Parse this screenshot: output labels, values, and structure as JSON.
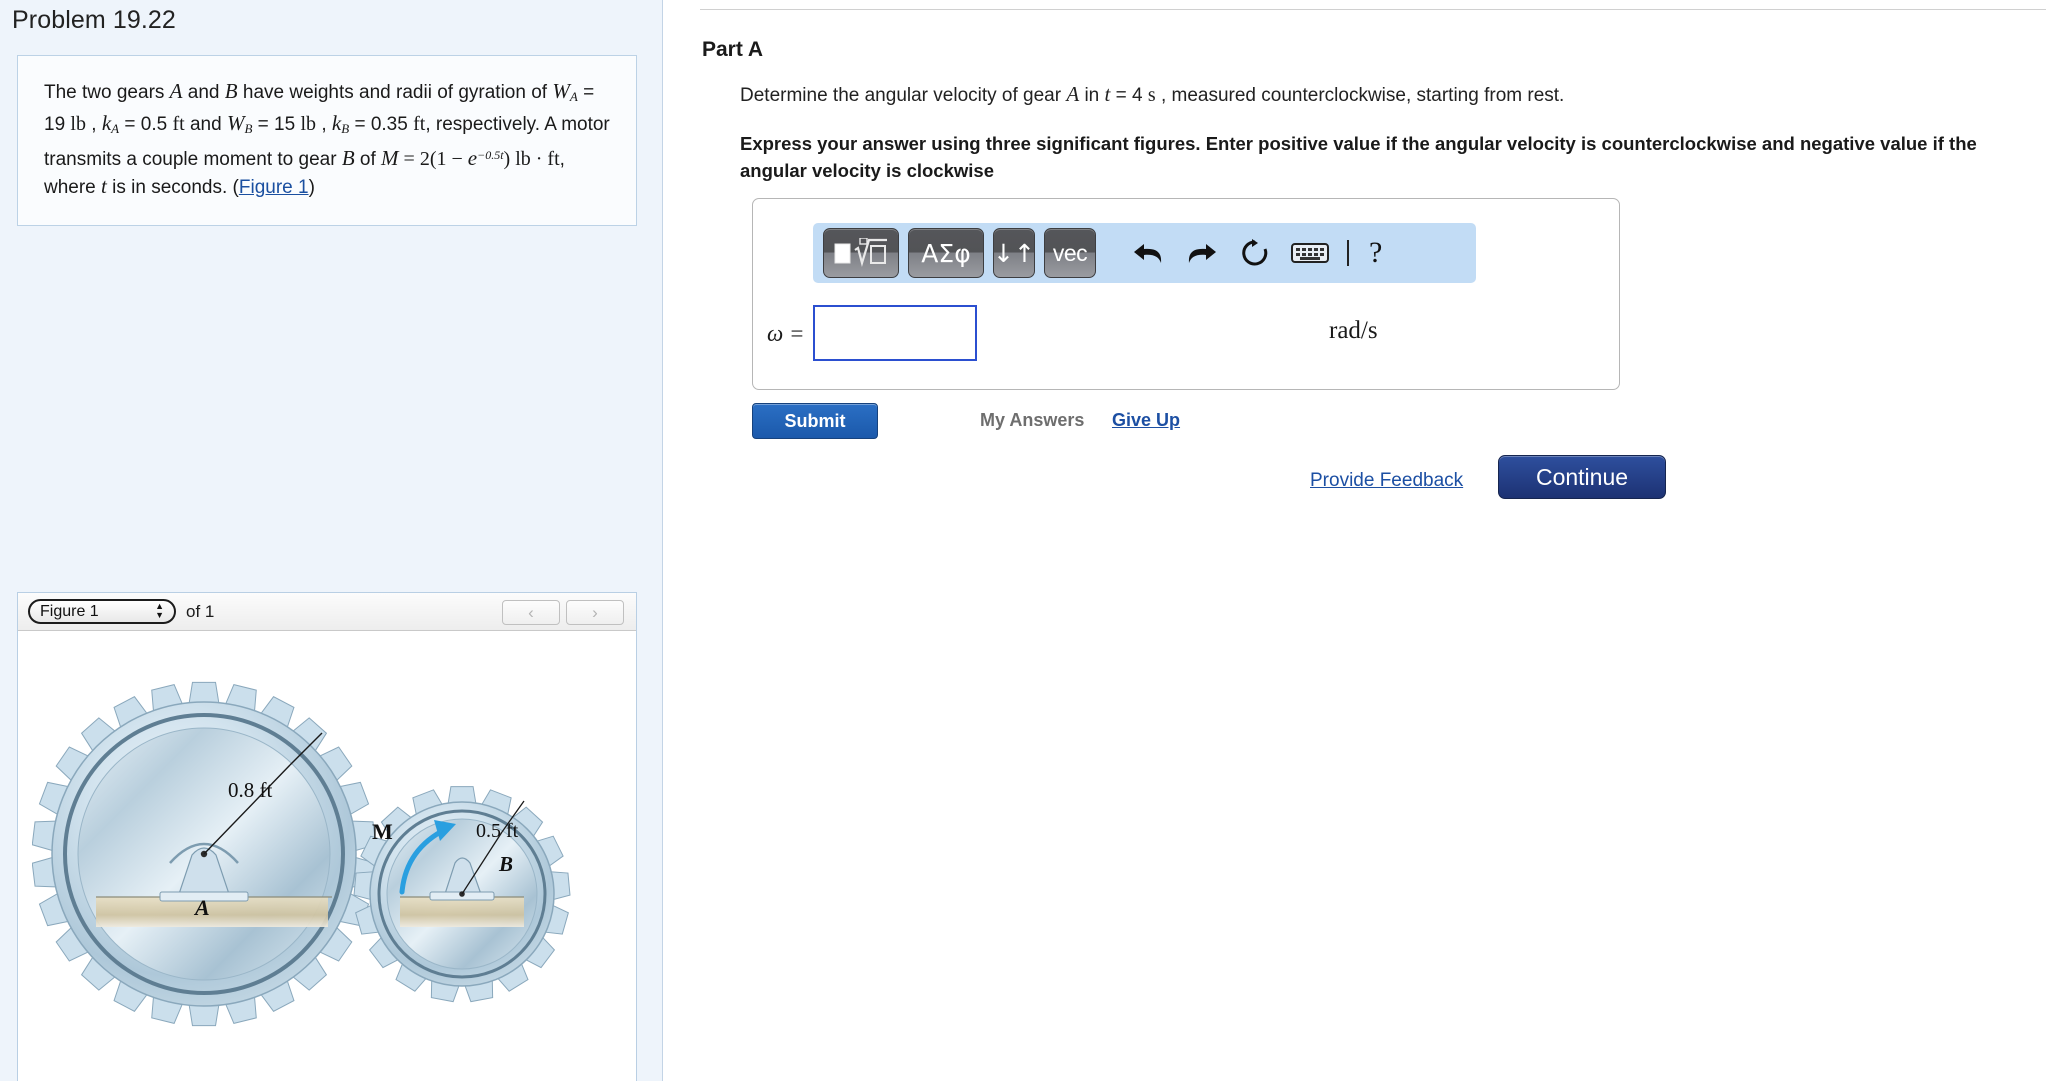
{
  "problem": {
    "title": "Problem 19.22",
    "statement_parts": {
      "p1": "The two gears ",
      "gear_a": "A",
      "p2": " and ",
      "gear_b": "B",
      "p3": " have weights and radii of gyration of ",
      "w_a": "W",
      "w_a_sub": "A",
      "eq1": " = 19 ",
      "unit_lb1": "lb",
      "comma1": " , ",
      "k_a": "k",
      "k_a_sub": "A",
      "eq2": " = 0.5 ",
      "unit_ft1": "ft",
      "and1": " and ",
      "w_b": "W",
      "w_b_sub": "B",
      "eq3": " = 15 ",
      "unit_lb2": "lb",
      "comma2": " , ",
      "k_b": "k",
      "k_b_sub": "B",
      "eq4": " = 0.35 ",
      "unit_ft2": "ft",
      "p4": ", respectively. A motor transmits a couple moment to gear ",
      "gear_b2": "B",
      "p5": " of ",
      "m_sym": "M",
      "m_eq": " = 2(1 − ",
      "e_sym": "e",
      "e_exp": "−0.5t",
      "m_close": ") ",
      "unit_lbft": "lb · ft",
      "p6": ", where ",
      "t_sym": "t",
      "p7": " is in seconds. (",
      "figure_link": "Figure 1",
      "p8": ")"
    }
  },
  "figure_panel": {
    "selected_figure": "Figure 1",
    "options": [
      "Figure 1"
    ],
    "of_label": "of 1",
    "prev_label": "‹",
    "next_label": "›",
    "figure_labels": {
      "radius_a": "0.8 ft",
      "radius_b": "0.5 ft",
      "gear_a": "A",
      "gear_b": "B",
      "moment": "M"
    }
  },
  "part": {
    "title": "Part A",
    "question_parts": {
      "q1": "Determine the angular velocity of gear ",
      "gear": "A",
      "q2": " in ",
      "t": "t",
      "q3": " = 4 ",
      "unit_s": "s",
      "q4": " , measured counterclockwise, starting from rest."
    },
    "instruction": "Express your answer using three significant figures. Enter positive value if the angular velocity is counterclockwise and negative value if the angular velocity is clockwise"
  },
  "toolbar": {
    "buttons": [
      {
        "name": "math-template",
        "label": "√"
      },
      {
        "name": "greek-symbols",
        "label": "ΑΣφ"
      },
      {
        "name": "super-subscript",
        "label": "↓↑"
      },
      {
        "name": "vector",
        "label": "vec"
      }
    ],
    "icons": [
      {
        "name": "undo-icon",
        "glyph": "↶"
      },
      {
        "name": "redo-icon",
        "glyph": "↷"
      },
      {
        "name": "reset-icon",
        "glyph": "↻"
      },
      {
        "name": "keyboard-icon",
        "glyph": "⌨"
      },
      {
        "name": "help-icon",
        "glyph": "?"
      }
    ]
  },
  "answer": {
    "variable_label": "ω =",
    "value": "",
    "placeholder": "",
    "units": "rad/s"
  },
  "actions": {
    "submit": "Submit",
    "my_answers": "My Answers",
    "give_up": "Give Up",
    "provide_feedback": "Provide Feedback",
    "continue": "Continue"
  },
  "colors": {
    "left_panel_bg": "#eef4fb",
    "problem_box_border": "#bcd2e6",
    "toolbar_bg": "#c2dcf5",
    "submit_blue": "#1b59ab",
    "continue_navy": "#1d3273",
    "link_blue": "#1c4fa3",
    "input_border": "#2b4fd0"
  }
}
